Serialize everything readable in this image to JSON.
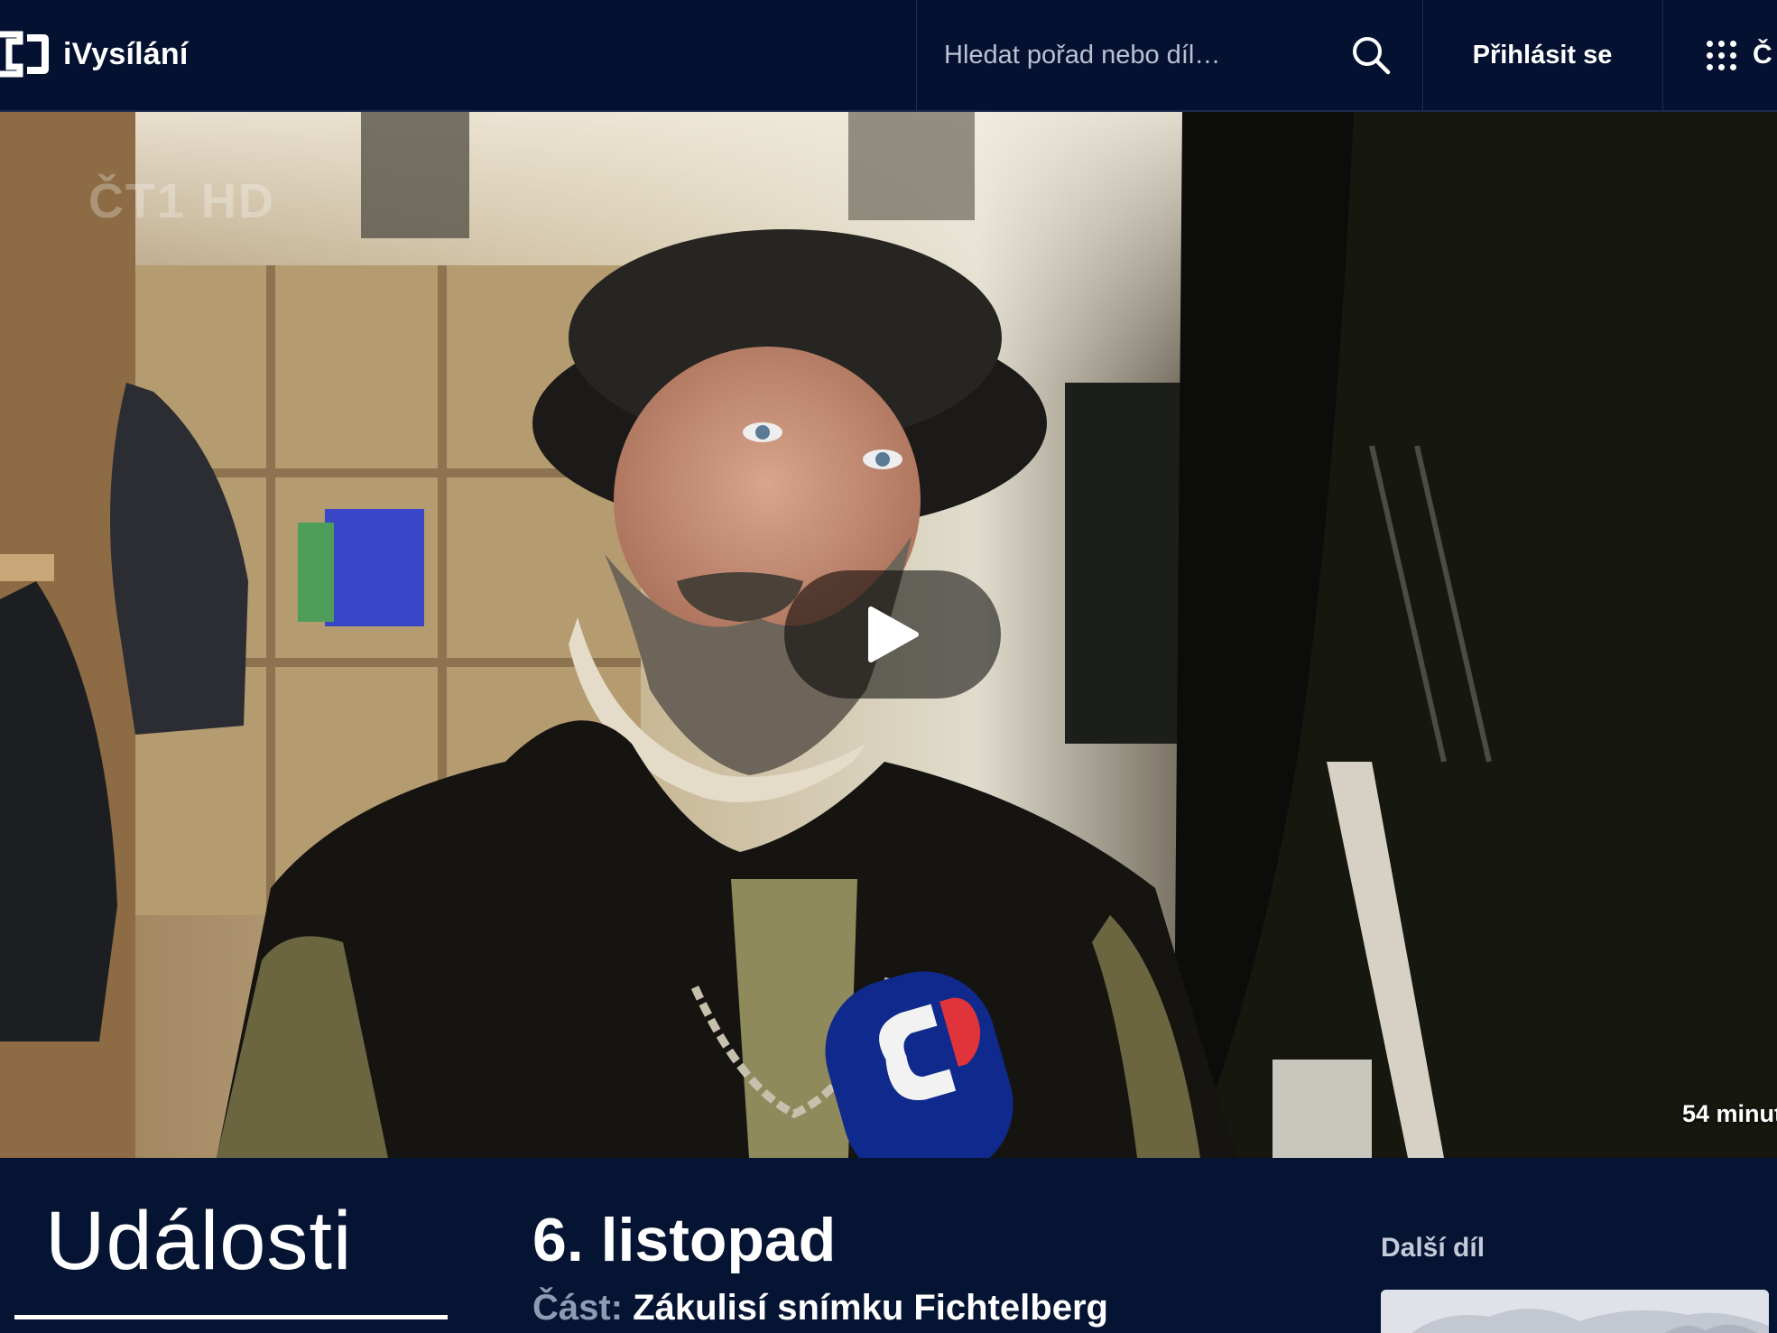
{
  "header": {
    "logo_text": "iVysílání",
    "search_placeholder": "Hledat pořad nebo díl…",
    "login_label": "Přihlásit se",
    "menu_label": "Č"
  },
  "video": {
    "watermark": "ČT1 HD",
    "duration": "54 minut",
    "play_icon": "play-icon"
  },
  "episode": {
    "show_title": "Události",
    "date": "6. listopad",
    "part_label": "Část:",
    "part_value": "Zákulisí snímku Fichtelberg"
  },
  "next_episode": {
    "label": "Další díl"
  },
  "colors": {
    "header_bg": "#041130",
    "page_bg": "#051433",
    "text": "#ffffff",
    "muted": "#8f9ab3"
  }
}
